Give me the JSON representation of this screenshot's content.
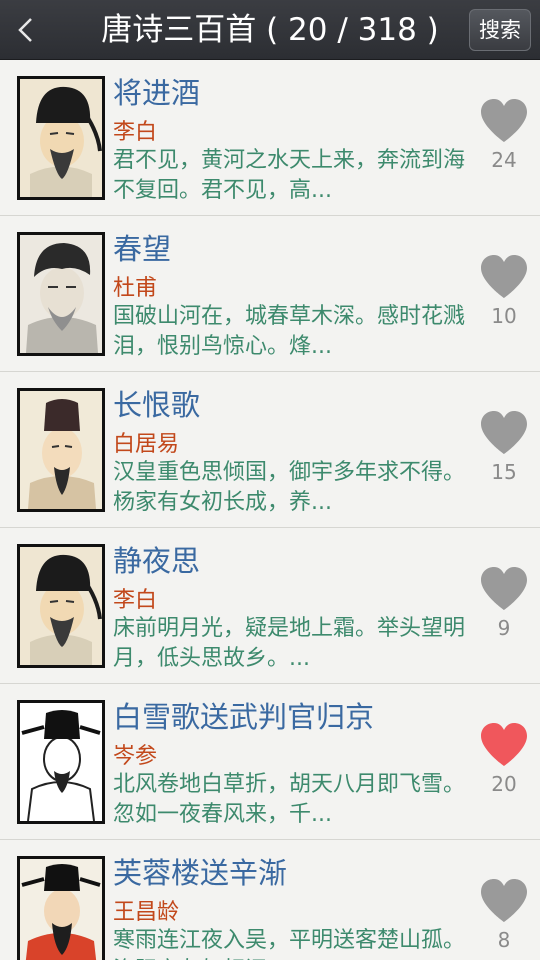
{
  "header": {
    "title": "唐诗三百首 ( 20 / 318 )",
    "search_label": "搜索"
  },
  "colors": {
    "title_bar": "#33353a",
    "poem_title": "#3a69a1",
    "poet": "#c2481b",
    "excerpt": "#3d8a6d",
    "like_inactive": "#9a9a9a",
    "like_active": "#f0575c"
  },
  "poems": [
    {
      "title": "将进酒",
      "poet": "李白",
      "excerpt": "君不见，黄河之水天上来，奔流到海不复回。君不见，高...",
      "likes": "24",
      "liked": false,
      "portrait": "li-bai-portrait"
    },
    {
      "title": "春望",
      "poet": "杜甫",
      "excerpt": "国破山河在，城春草木深。感时花溅泪，恨别鸟惊心。烽...",
      "likes": "10",
      "liked": false,
      "portrait": "du-fu-portrait"
    },
    {
      "title": "长恨歌",
      "poet": "白居易",
      "excerpt": "汉皇重色思倾国，御宇多年求不得。杨家有女初长成，养...",
      "likes": "15",
      "liked": false,
      "portrait": "bai-juyi-portrait"
    },
    {
      "title": "静夜思",
      "poet": "李白",
      "excerpt": "床前明月光，疑是地上霜。举头望明月，低头思故乡。...",
      "likes": "9",
      "liked": false,
      "portrait": "li-bai-portrait"
    },
    {
      "title": "白雪歌送武判官归京",
      "poet": "岑参",
      "excerpt": "北风卷地白草折，胡天八月即飞雪。忽如一夜春风来，千...",
      "likes": "20",
      "liked": true,
      "portrait": "cen-shen-portrait"
    },
    {
      "title": "芙蓉楼送辛渐",
      "poet": "王昌龄",
      "excerpt": "寒雨连江夜入吴，平明送客楚山孤。洛阳亲友如相问，一...",
      "likes": "8",
      "liked": false,
      "portrait": "wang-changling-portrait"
    }
  ]
}
